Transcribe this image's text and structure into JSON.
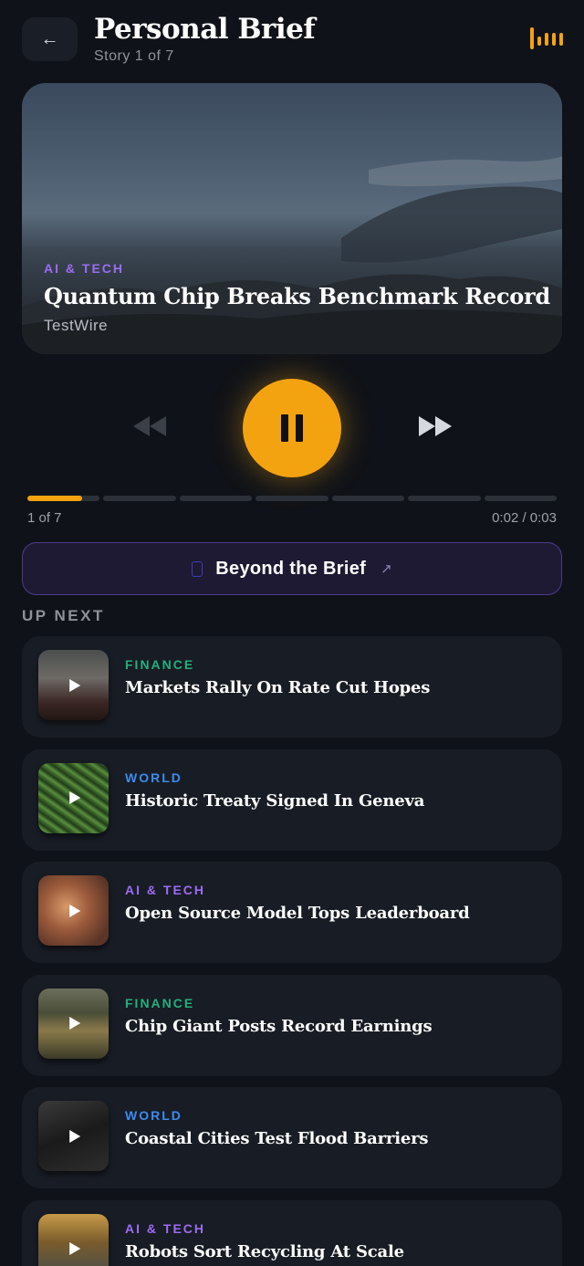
{
  "header": {
    "back_icon": "←",
    "title": "Personal Brief",
    "subtitle": "Story 1 of 7",
    "equalizer_icon": "equalizer-icon"
  },
  "now_playing": {
    "category": "AI & TECH",
    "title": "Quantum Chip Breaks Benchmark Record",
    "source": "TestWire"
  },
  "controls": {
    "rewind_icon": "rewind-icon",
    "pause_icon": "pause-icon",
    "forward_icon": "fast-forward-icon",
    "accent_color": "#f4a310"
  },
  "progress": {
    "current_story_fraction": 0.75,
    "count_label": "1 of 7",
    "time_label": "0:02 / 0:03"
  },
  "beyond": {
    "label": "Beyond the Brief",
    "arrow": "↗"
  },
  "up_next": {
    "heading": "UP NEXT",
    "items": [
      {
        "category": "FINANCE",
        "category_color": "#22b07d",
        "title": "Markets Rally On Rate Cut Hopes"
      },
      {
        "category": "WORLD",
        "category_color": "#3d8bef",
        "title": "Historic Treaty Signed In Geneva"
      },
      {
        "category": "AI & TECH",
        "category_color": "#9b6cf3",
        "title": "Open Source Model Tops Leaderboard"
      },
      {
        "category": "FINANCE",
        "category_color": "#22b07d",
        "title": "Chip Giant Posts Record Earnings"
      },
      {
        "category": "WORLD",
        "category_color": "#3d8bef",
        "title": "Coastal Cities Test Flood Barriers"
      },
      {
        "category": "AI & TECH",
        "category_color": "#9b6cf3",
        "title": "Robots Sort Recycling At Scale"
      }
    ]
  }
}
